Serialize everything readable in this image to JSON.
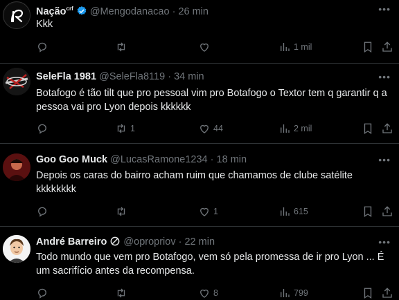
{
  "tweets": [
    {
      "author": "Nação",
      "author_badge": "crf",
      "handle": "@Mengodanacao",
      "time": "26 min",
      "text": "Kkk",
      "replies": "",
      "retweets": "",
      "likes": "",
      "views": "1 mil"
    },
    {
      "author": "SeleFla 1981",
      "handle": "@SeleFla8119",
      "time": "34 min",
      "text": "Botafogo é tão tilt que pro pessoal vim pro Botafogo o Textor tem q garantir q a pessoa vai pro Lyon depois kkkkkk",
      "replies": "",
      "retweets": "1",
      "likes": "44",
      "views": "2 mil"
    },
    {
      "author": "Goo Goo Muck",
      "handle": "@LucasRamone1234",
      "time": "18 min",
      "text": "Depois os caras do bairro acham ruim que chamamos de clube satélite kkkkkkkk",
      "replies": "",
      "retweets": "",
      "likes": "1",
      "views": "615"
    },
    {
      "author": "André Barreiro",
      "handle": "@opropriov",
      "time": "22 min",
      "text": "Todo mundo que vem pro Botafogo, vem só pela promessa de ir pro Lyon ... É um sacrifício antes da recompensa.",
      "replies": "",
      "retweets": "",
      "likes": "8",
      "views": "799"
    }
  ],
  "colors": {
    "background": "#000000",
    "text": "#e7e9ea",
    "muted": "#71767b",
    "verified": "#1d9bf0",
    "divider": "#2f3336"
  },
  "icons": [
    "reply-icon",
    "retweet-icon",
    "like-icon",
    "views-icon",
    "bookmark-icon",
    "share-icon",
    "more-icon",
    "verified-icon"
  ]
}
